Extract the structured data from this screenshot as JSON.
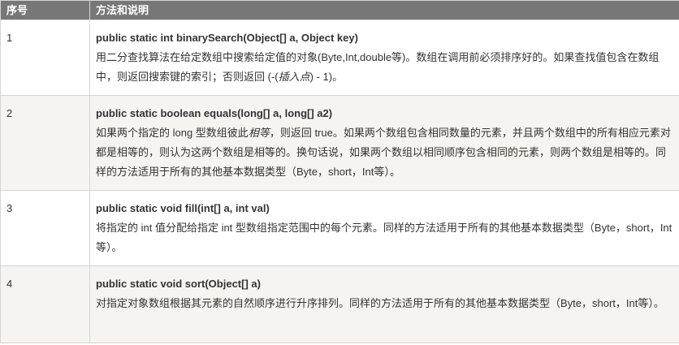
{
  "table": {
    "headers": {
      "number": "序号",
      "method": "方法和说明"
    },
    "rows": [
      {
        "number": "1",
        "signature": "public static int binarySearch(Object[] a, Object key)",
        "desc_before": "用二分查找算法在给定数组中搜索给定值的对象(Byte,Int,double等)。数组在调用前必须排序好的。如果查找值包含在数组中，则返回搜索键的索引；否则返回 (-(",
        "desc_em": "插入点",
        "desc_after": ") - 1)。"
      },
      {
        "number": "2",
        "signature": "public static boolean equals(long[] a, long[] a2)",
        "desc_before": "如果两个指定的 long 型数组彼此",
        "desc_em": "相等",
        "desc_after": "，则返回 true。如果两个数组包含相同数量的元素，并且两个数组中的所有相应元素对都是相等的，则认为这两个数组是相等的。换句话说，如果两个数组以相同顺序包含相同的元素，则两个数组是相等的。同样的方法适用于所有的其他基本数据类型（Byte，short，Int等）。"
      },
      {
        "number": "3",
        "signature": "public static void fill(int[] a, int val)",
        "desc_before": "将指定的 int 值分配给指定 int 型数组指定范围中的每个元素。同样的方法适用于所有的其他基本数据类型（Byte，short，Int等）。",
        "desc_em": "",
        "desc_after": ""
      },
      {
        "number": "4",
        "signature": "public static void sort(Object[] a)",
        "desc_before": "对指定对象数组根据其元素的自然顺序进行升序排列。同样的方法适用于所有的其他基本数据类型（Byte，short，Int等）。",
        "desc_em": "",
        "desc_after": ""
      }
    ]
  }
}
